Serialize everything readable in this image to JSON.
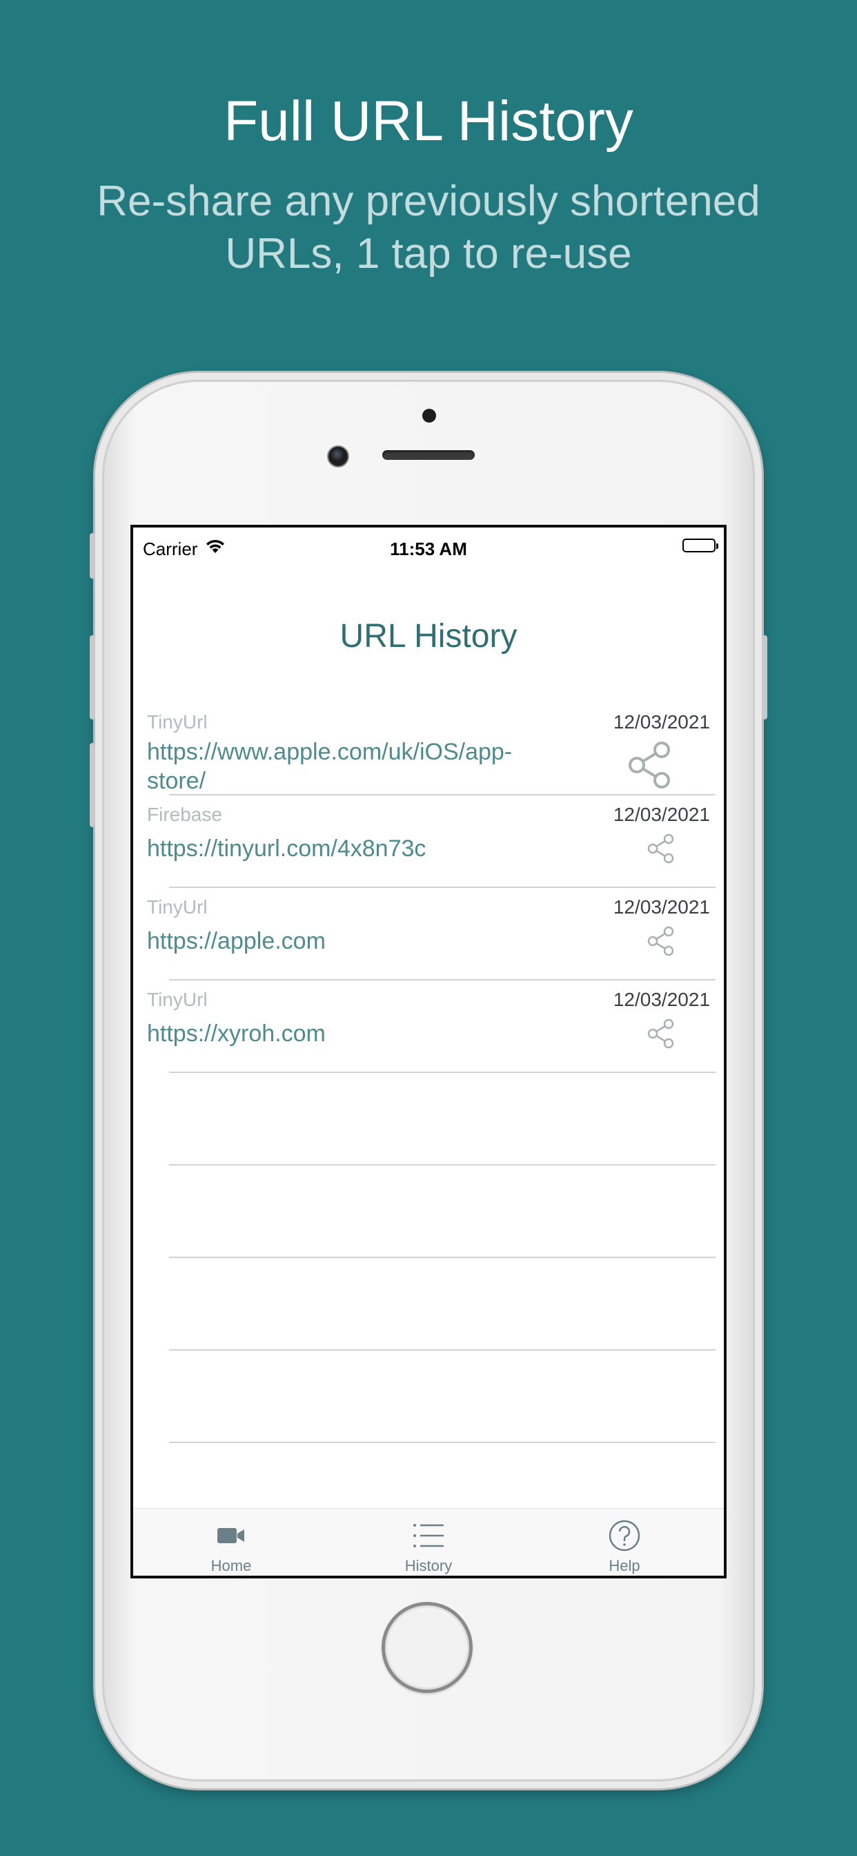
{
  "marketing": {
    "headline": "Full URL History",
    "subline": "Re-share any previously shortened URLs, 1 tap to re-use"
  },
  "status_bar": {
    "carrier": "Carrier",
    "time": "11:53 AM"
  },
  "screen": {
    "title": "URL History"
  },
  "history": [
    {
      "service": "TinyUrl",
      "date": "12/03/2021",
      "url": "https://www.apple.com/uk/iOS/app-store/"
    },
    {
      "service": "Firebase",
      "date": "12/03/2021",
      "url": "https://tinyurl.com/4x8n73c"
    },
    {
      "service": "TinyUrl",
      "date": "12/03/2021",
      "url": "https://apple.com"
    },
    {
      "service": "TinyUrl",
      "date": "12/03/2021",
      "url": "https://xyroh.com"
    }
  ],
  "tab_bar": {
    "items": [
      {
        "label": "Home",
        "icon": "video-camera-icon"
      },
      {
        "label": "History",
        "icon": "list-icon"
      },
      {
        "label": "Help",
        "icon": "question-circle-icon"
      }
    ]
  },
  "colors": {
    "background": "#22797e",
    "accent": "#4d8b8e",
    "title": "#2f6f72"
  }
}
